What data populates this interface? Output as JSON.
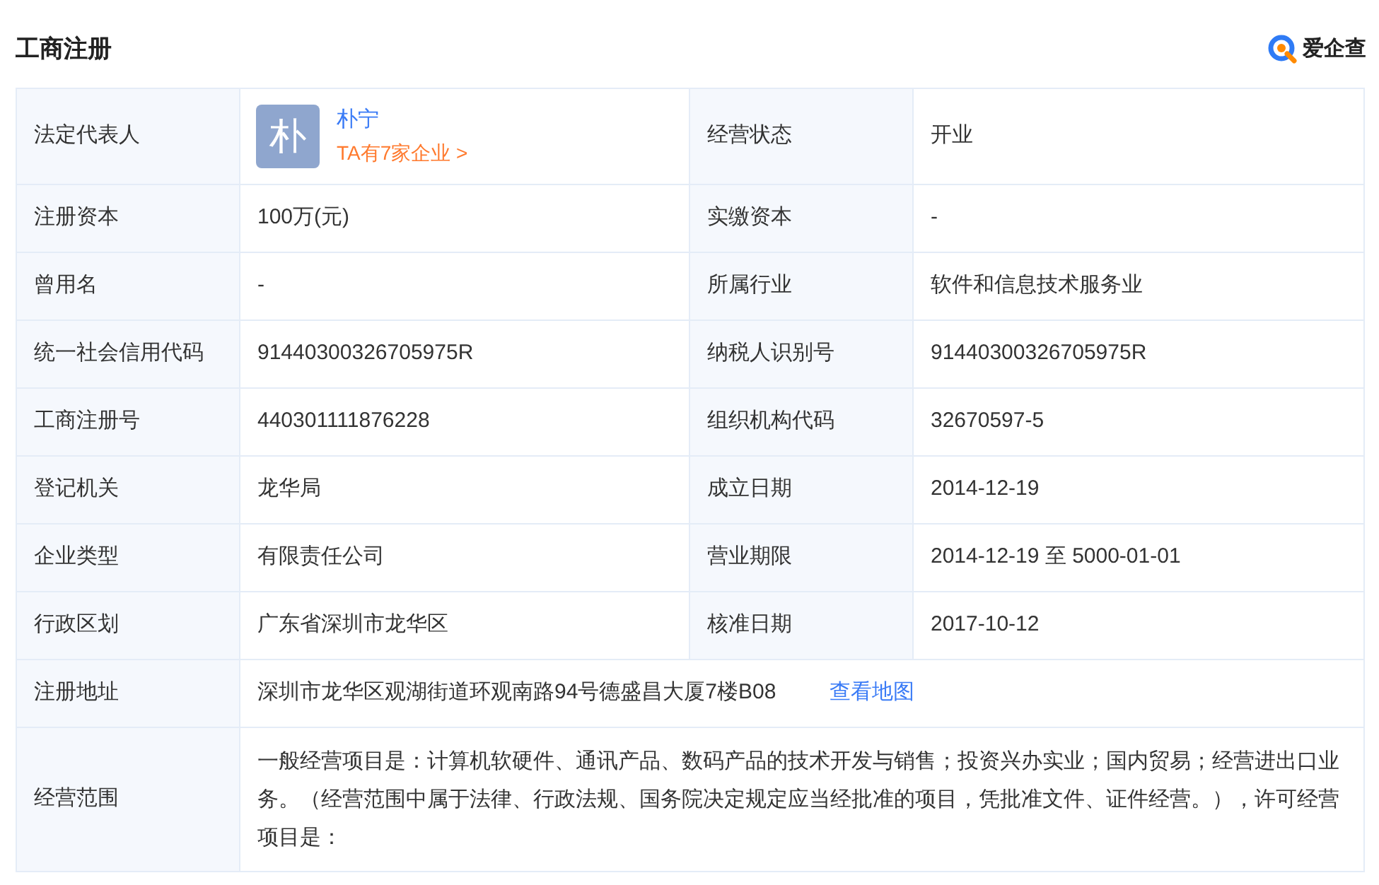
{
  "title": "工商注册",
  "logo": {
    "text": "爱企查"
  },
  "rows": [
    {
      "kind": "person",
      "label": "法定代表人",
      "avatar": "朴",
      "name": "朴宁",
      "link": "TA有7家企业 >",
      "label_2": "经营状态",
      "value_2": "开业"
    },
    {
      "kind": "pair",
      "label": "注册资本",
      "value": "100万(元)",
      "label_2": "实缴资本",
      "value_2": "-"
    },
    {
      "kind": "pair",
      "label": "曾用名",
      "value": "-",
      "label_2": "所属行业",
      "value_2": "软件和信息技术服务业"
    },
    {
      "kind": "pair",
      "label": "统一社会信用代码",
      "value": "91440300326705975R",
      "label_2": "纳税人识别号",
      "value_2": "91440300326705975R"
    },
    {
      "kind": "pair",
      "label": "工商注册号",
      "value": "440301111876228",
      "label_2": "组织机构代码",
      "value_2": "32670597-5"
    },
    {
      "kind": "pair",
      "label": "登记机关",
      "value": "龙华局",
      "label_2": "成立日期",
      "value_2": "2014-12-19"
    },
    {
      "kind": "pair",
      "label": "企业类型",
      "value": "有限责任公司",
      "label_2": "营业期限",
      "value_2": "2014-12-19 至 5000-01-01"
    },
    {
      "kind": "pair",
      "label": "行政区划",
      "value": "广东省深圳市龙华区",
      "label_2": "核准日期",
      "value_2": "2017-10-12"
    },
    {
      "kind": "address",
      "label": "注册地址",
      "value": "深圳市龙华区观湖街道环观南路94号德盛昌大厦7楼B08",
      "link": "查看地图"
    },
    {
      "kind": "scope",
      "label": "经营范围",
      "value": "一般经营项目是：计算机软硬件、通讯产品、数码产品的技术开发与销售；投资兴办实业；国内贸易；经营进出口业务。（经营范围中属于法律、行政法规、国务院决定规定应当经批准的项目，凭批准文件、证件经营。），许可经营项目是："
    }
  ]
}
